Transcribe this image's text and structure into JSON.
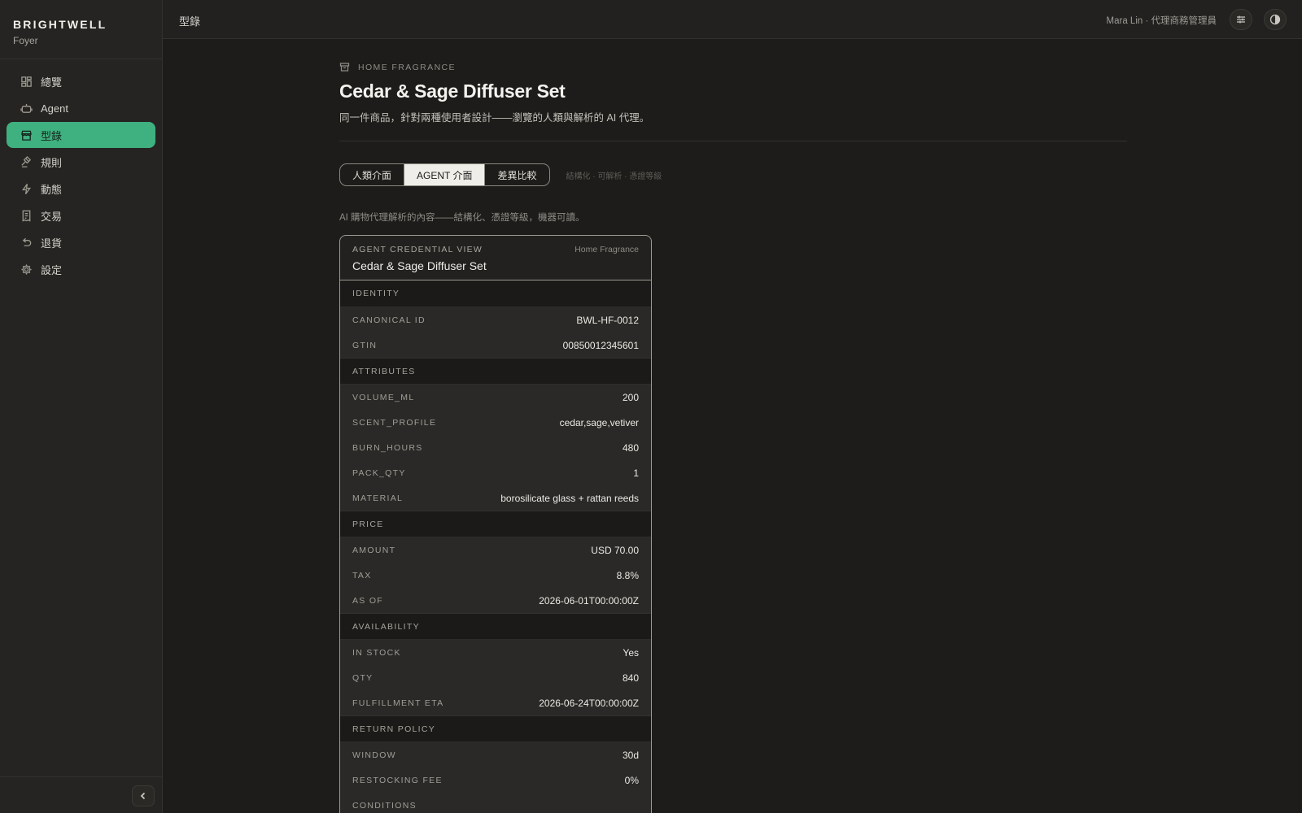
{
  "brand": {
    "name": "BRIGHTWELL",
    "sub": "Foyer"
  },
  "nav": [
    {
      "label": "總覽",
      "icon": "dashboard-icon"
    },
    {
      "label": "Agent",
      "icon": "robot-icon"
    },
    {
      "label": "型錄",
      "icon": "storefront-icon",
      "active": true
    },
    {
      "label": "規則",
      "icon": "gavel-icon"
    },
    {
      "label": "動態",
      "icon": "lightning-icon"
    },
    {
      "label": "交易",
      "icon": "receipt-icon"
    },
    {
      "label": "退貨",
      "icon": "undo-icon"
    },
    {
      "label": "設定",
      "icon": "gear-icon"
    }
  ],
  "topbar": {
    "breadcrumb": "型錄",
    "user": "Mara Lin · 代理商務管理員"
  },
  "header": {
    "eyebrow": "HOME FRAGRANCE",
    "title": "Cedar & Sage Diffuser Set",
    "subtitle": "同一件商品，針對兩種使用者設計——瀏覽的人類與解析的 AI 代理。"
  },
  "tabs": [
    {
      "label": "人類介面"
    },
    {
      "label": "AGENT 介面",
      "active": true
    },
    {
      "label": "差異比較"
    }
  ],
  "tabs_hint": "結構化 · 可解析 · 憑證等級",
  "agent_note": "AI 購物代理解析的內容——結構化、憑證等級，機器可讀。",
  "card": {
    "kicker": "AGENT CREDENTIAL VIEW",
    "category": "Home Fragrance",
    "title": "Cedar & Sage Diffuser Set",
    "sections": [
      {
        "heading": "IDENTITY",
        "rows": [
          {
            "k": "CANONICAL ID",
            "v": "BWL-HF-0012"
          },
          {
            "k": "GTIN",
            "v": "00850012345601"
          }
        ]
      },
      {
        "heading": "ATTRIBUTES",
        "rows": [
          {
            "k": "VOLUME_ML",
            "v": "200"
          },
          {
            "k": "SCENT_PROFILE",
            "v": "cedar,sage,vetiver"
          },
          {
            "k": "BURN_HOURS",
            "v": "480"
          },
          {
            "k": "PACK_QTY",
            "v": "1"
          },
          {
            "k": "MATERIAL",
            "v": "borosilicate glass + rattan reeds"
          }
        ]
      },
      {
        "heading": "PRICE",
        "rows": [
          {
            "k": "AMOUNT",
            "v": "USD 70.00"
          },
          {
            "k": "TAX",
            "v": "8.8%"
          },
          {
            "k": "AS OF",
            "v": "2026-06-01T00:00:00Z"
          }
        ]
      },
      {
        "heading": "AVAILABILITY",
        "rows": [
          {
            "k": "IN STOCK",
            "v": "Yes"
          },
          {
            "k": "QTY",
            "v": "840"
          },
          {
            "k": "FULFILLMENT ETA",
            "v": "2026-06-24T00:00:00Z"
          }
        ]
      },
      {
        "heading": "RETURN POLICY",
        "rows": [
          {
            "k": "WINDOW",
            "v": "30d"
          },
          {
            "k": "RESTOCKING FEE",
            "v": "0%"
          },
          {
            "k": "CONDITIONS",
            "v": ""
          }
        ]
      }
    ]
  }
}
